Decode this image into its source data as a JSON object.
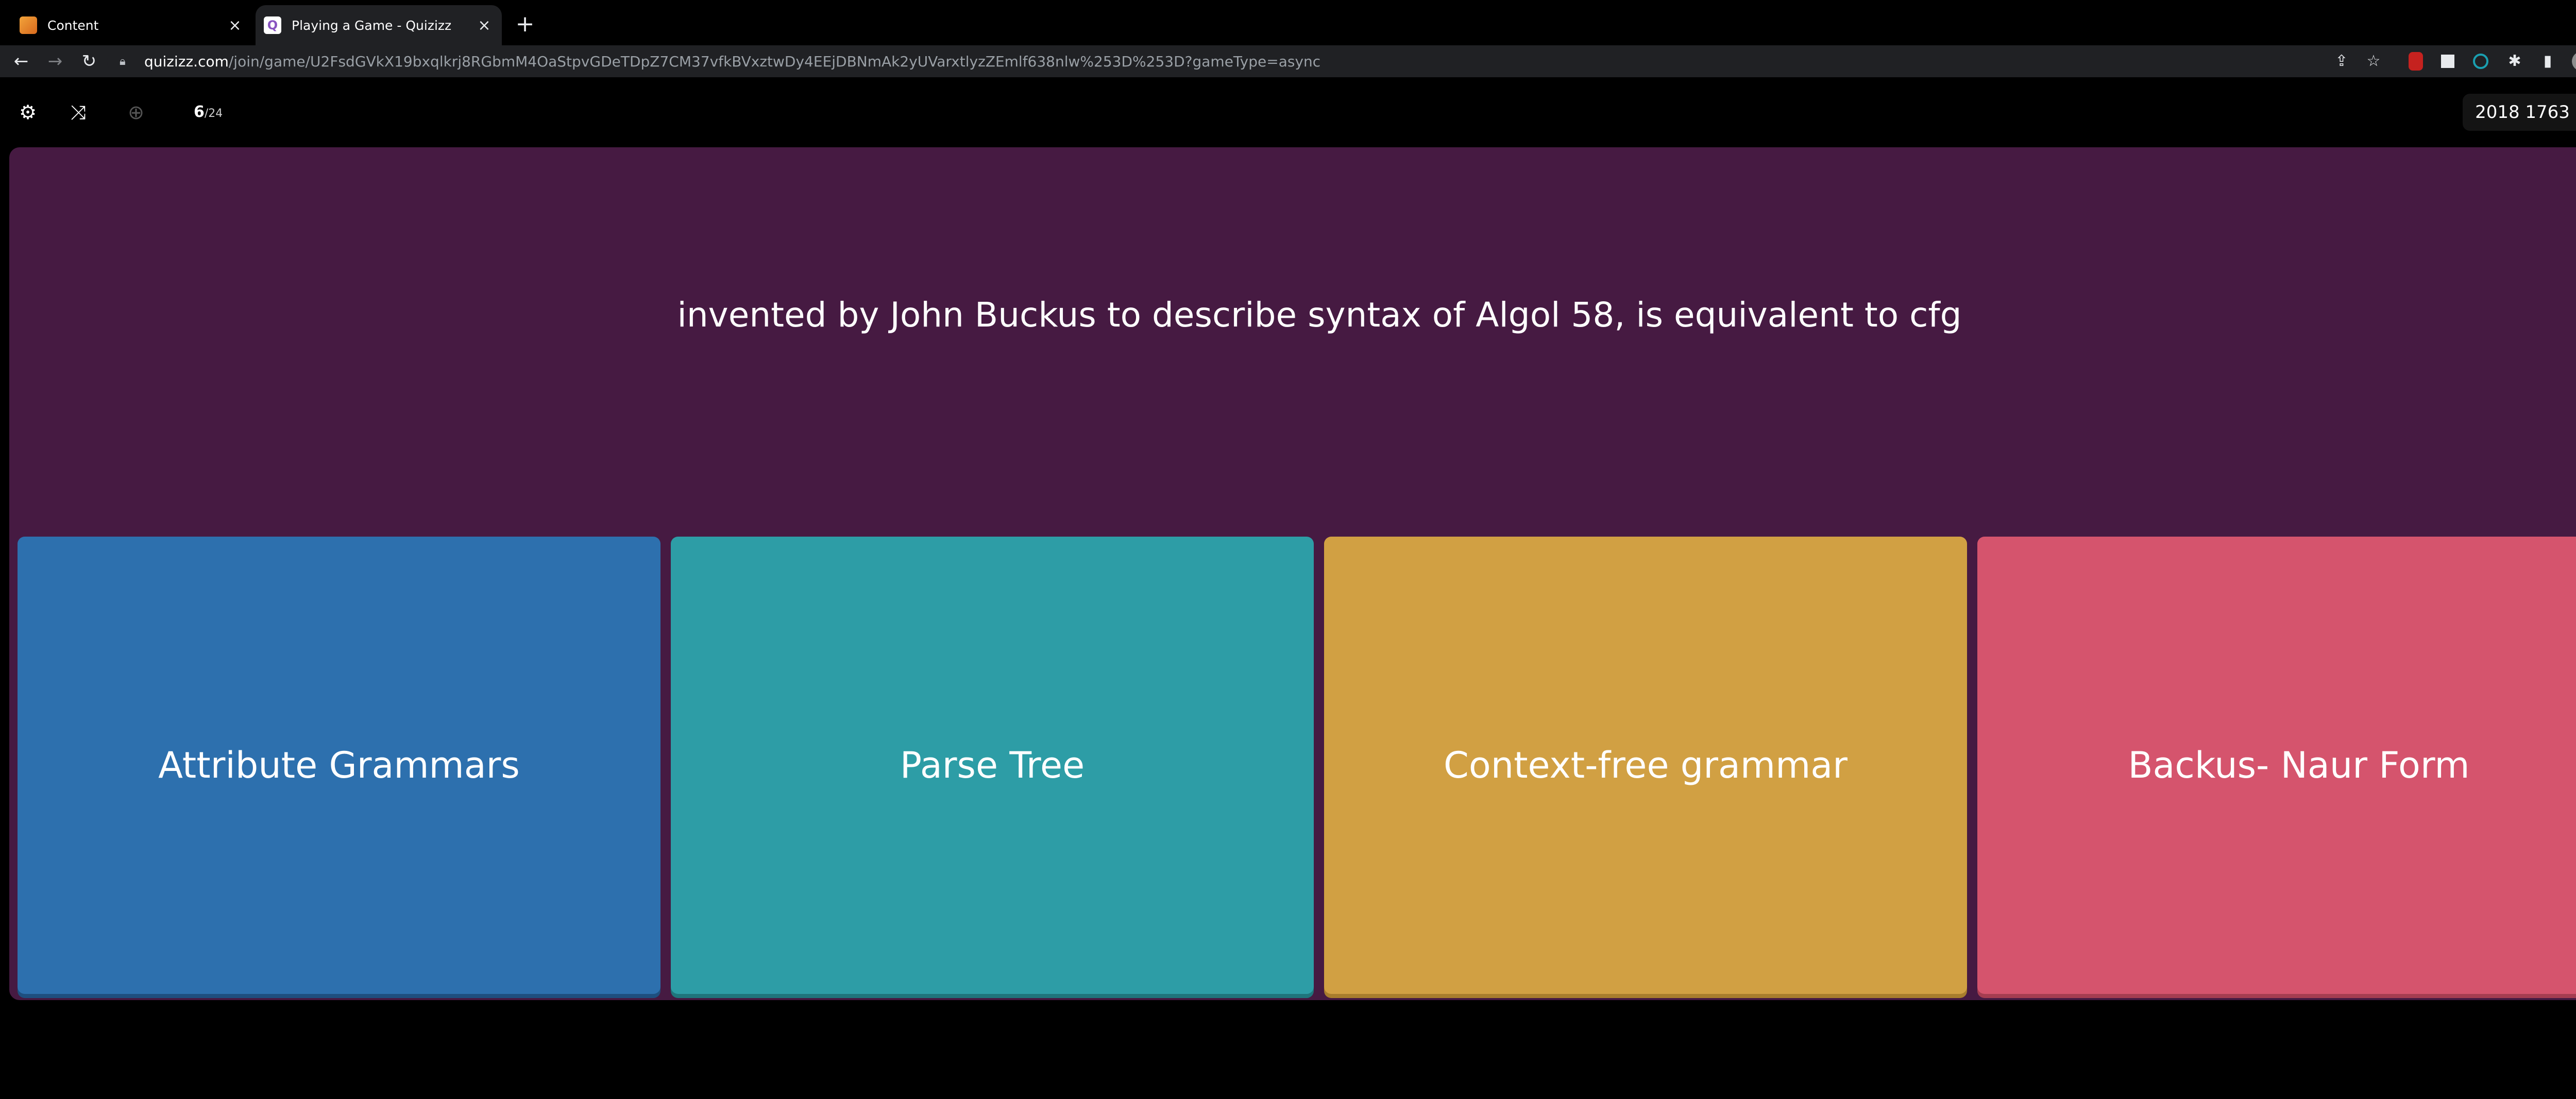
{
  "browser": {
    "tabs": [
      {
        "title": "Content",
        "favicon": "content-favicon",
        "active": false
      },
      {
        "title": "Playing a Game - Quizizz",
        "favicon": "quizizz-favicon",
        "active": true
      }
    ],
    "url_host": "quizizz.com",
    "url_path": "/join/game/U2FsdGVkX19bxqlkrj8RGbmM4OaStpvGDeTDpZ7CM37vfkBVxztwDy4EEjDBNmAk2yUVarxtlyzZEmlf638nlw%253D%253D?gameType=async"
  },
  "game": {
    "question_index": "6",
    "question_total": "/24",
    "score": "2018 1763",
    "question": "invented by John Buckus to describe syntax of Algol 58, is equivalent to cfg",
    "options": [
      {
        "label": "Attribute Grammars",
        "color": "#2d70ae"
      },
      {
        "label": "Parse Tree",
        "color": "#2d9da6"
      },
      {
        "label": "Context-free grammar",
        "color": "#d1a043"
      },
      {
        "label": "Backus- Naur Form",
        "color": "#d5546d"
      }
    ],
    "panel_color": "#461a42"
  },
  "icons": {
    "settings": "gear-icon",
    "power_ups": "crossed-arrows-icon",
    "zoom": "zoom-in-icon",
    "fullscreen": "fullscreen-icon"
  }
}
